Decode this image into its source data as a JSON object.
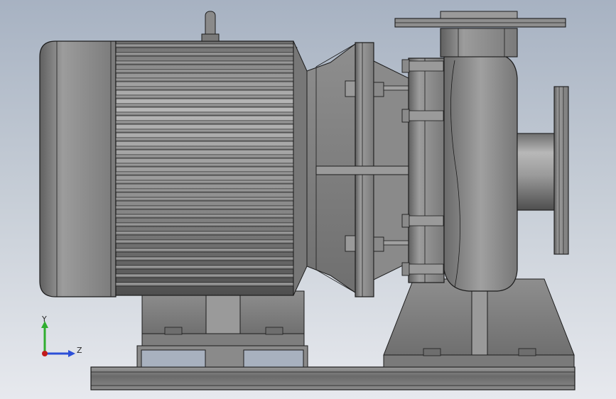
{
  "viewport": {
    "background_top": "#a7b2c2",
    "background_bottom": "#e7e9ee"
  },
  "triad": {
    "y_label": "Y",
    "z_label": "Z",
    "y_color": "#2fae2f",
    "z_color": "#2b4fd8",
    "x_color": "#c21b1b"
  },
  "model": {
    "name_icon": "centrifugal-pump-motor-assembly-icon",
    "body_color": "#8c8c8c",
    "edge_color": "#1c1c1c"
  }
}
